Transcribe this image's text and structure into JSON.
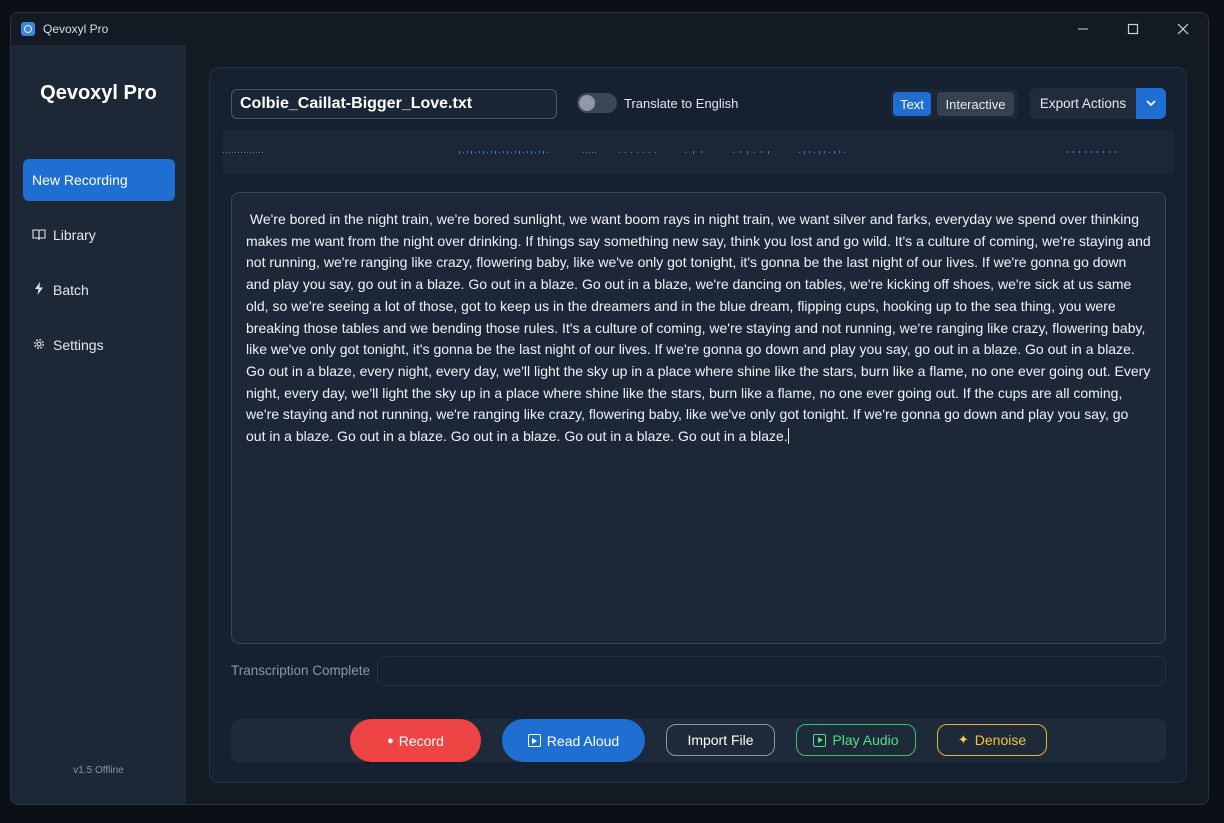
{
  "window": {
    "title": "Qevoxyl Pro",
    "controls": {
      "minimize": "—",
      "maximize": "☐",
      "close": "✕"
    }
  },
  "sidebar": {
    "brand": "Qevoxyl Pro",
    "items": [
      {
        "label": "New Recording",
        "icon": "",
        "active": true
      },
      {
        "label": "Library",
        "icon": "book-icon"
      },
      {
        "label": "Batch",
        "icon": "bolt-icon"
      },
      {
        "label": "Settings",
        "icon": "gear-icon"
      }
    ],
    "version": "v1.5 Offline"
  },
  "toolbar": {
    "filename": "Colbie_Caillat-Bigger_Love.txt",
    "translate_label": "Translate to English",
    "translate_on": false,
    "view_text": "Text",
    "view_interactive": "Interactive",
    "export_label": "Export Actions"
  },
  "transcript": {
    "text": " We're bored in the night train, we're bored sunlight, we want boom rays in night train, we want silver and farks, everyday we spend over thinking makes me want from the night over drinking. If things say something new say, think you lost and go wild. It's a culture of coming, we're staying and not running, we're ranging like crazy, flowering baby, like we've only got tonight, it's gonna be the last night of our lives. If we're gonna go down and play you say, go out in a blaze. Go out in a blaze. Go out in a blaze, we're dancing on tables, we're kicking off shoes, we're sick at us same old, so we're seeing a lot of those, got to keep us in the dreamers and in the blue dream, flipping cups, hooking up to the sea thing, you were breaking those tables and we bending those rules. It's a culture of coming, we're staying and not running, we're ranging like crazy, flowering baby, like we've only got tonight, it's gonna be the last night of our lives. If we're gonna go down and play you say, go out in a blaze. Go out in a blaze. Go out in a blaze, every night, every day, we'll light the sky up in a place where shine like the stars, burn like a flame, no one ever going out. Every night, every day, we'll light the sky up in a place where shine like the stars, burn like a flame, no one ever going out. If the cups are all coming, we're staying and not running, we're ranging like crazy, flowering baby, like we've only got tonight. If we're gonna go down and play you say, go out in a blaze. Go out in a blaze. Go out in a blaze. Go out in a blaze. Go out in a blaze."
  },
  "status": {
    "text": "Transcription Complete",
    "progress": 0
  },
  "actions": {
    "record": "Record",
    "read_aloud": "Read Aloud",
    "import": "Import File",
    "play": "Play Audio",
    "denoise": "Denoise"
  },
  "colors": {
    "accent": "#1f6fd3",
    "record": "#ef4444",
    "play": "#34c76a",
    "denoise": "#e7b620",
    "background": "#121a24"
  }
}
